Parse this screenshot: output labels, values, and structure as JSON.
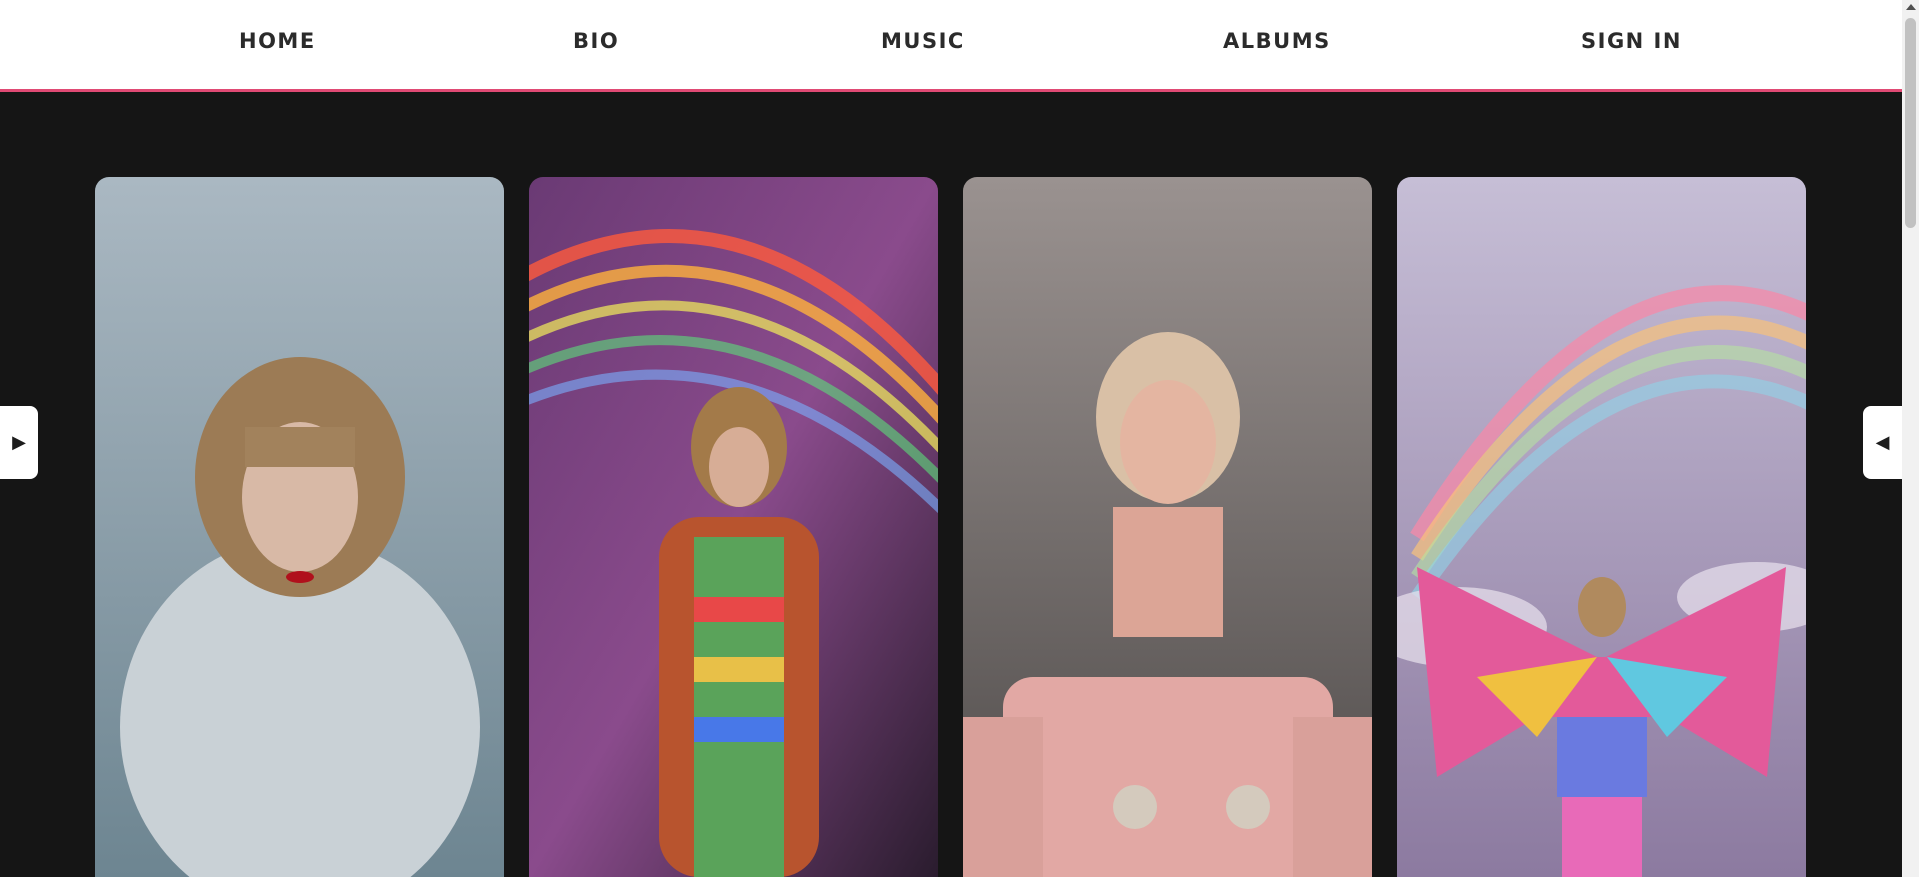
{
  "nav": {
    "items": [
      {
        "label": "HOME"
      },
      {
        "label": "BIO"
      },
      {
        "label": "MUSIC"
      },
      {
        "label": "ALBUMS"
      },
      {
        "label": "SIGN IN"
      }
    ]
  },
  "carousel": {
    "prev_icon": "▶",
    "next_icon": "◀"
  },
  "colors": {
    "accent": "#e04a74",
    "background": "#151515",
    "nav_background": "#ffffff"
  }
}
